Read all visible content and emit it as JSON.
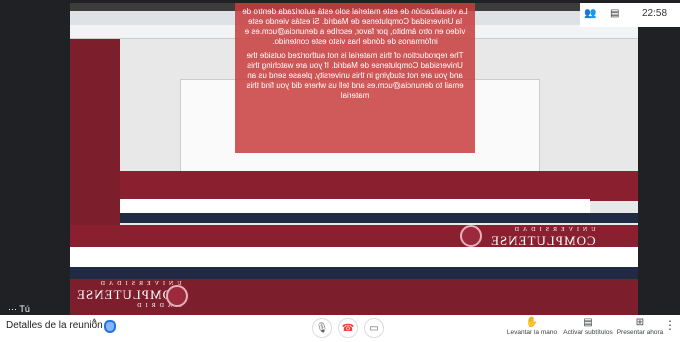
{
  "notice": {
    "es": "La visualización de este material solo está autorizada dentro de la Universidad Complutense de Madrid. Si estás viendo este vídeo en otro ámbito, por favor, escribe a denuncia@ucm.es e infórmanos de dónde has visto este contenido.",
    "en": "The reproduction of this material is not authorized outside the Universidad Complutense de Madrid. If you are watching this and you are not studying in this university, please send us an email to denuncia@ucm.es and tell us where did you find this material"
  },
  "logo": {
    "sub": "UNIVERSIDAD",
    "main": "COMPLUTENSE",
    "city": "MADRID"
  },
  "clock": {
    "time": "22:58"
  },
  "selfview": {
    "label": "Tú"
  },
  "bottom_bar": {
    "meeting_details": "Detalles de la reunión",
    "chevron": "^",
    "raise_hand": "Levantar la mano",
    "captions": "Activar subtítulos",
    "present": "Presentar ahora",
    "more": "⋮"
  },
  "colors": {
    "ucm_red": "#7d1e2c",
    "meet_dark": "#202124",
    "end_call": "#ea4335"
  }
}
